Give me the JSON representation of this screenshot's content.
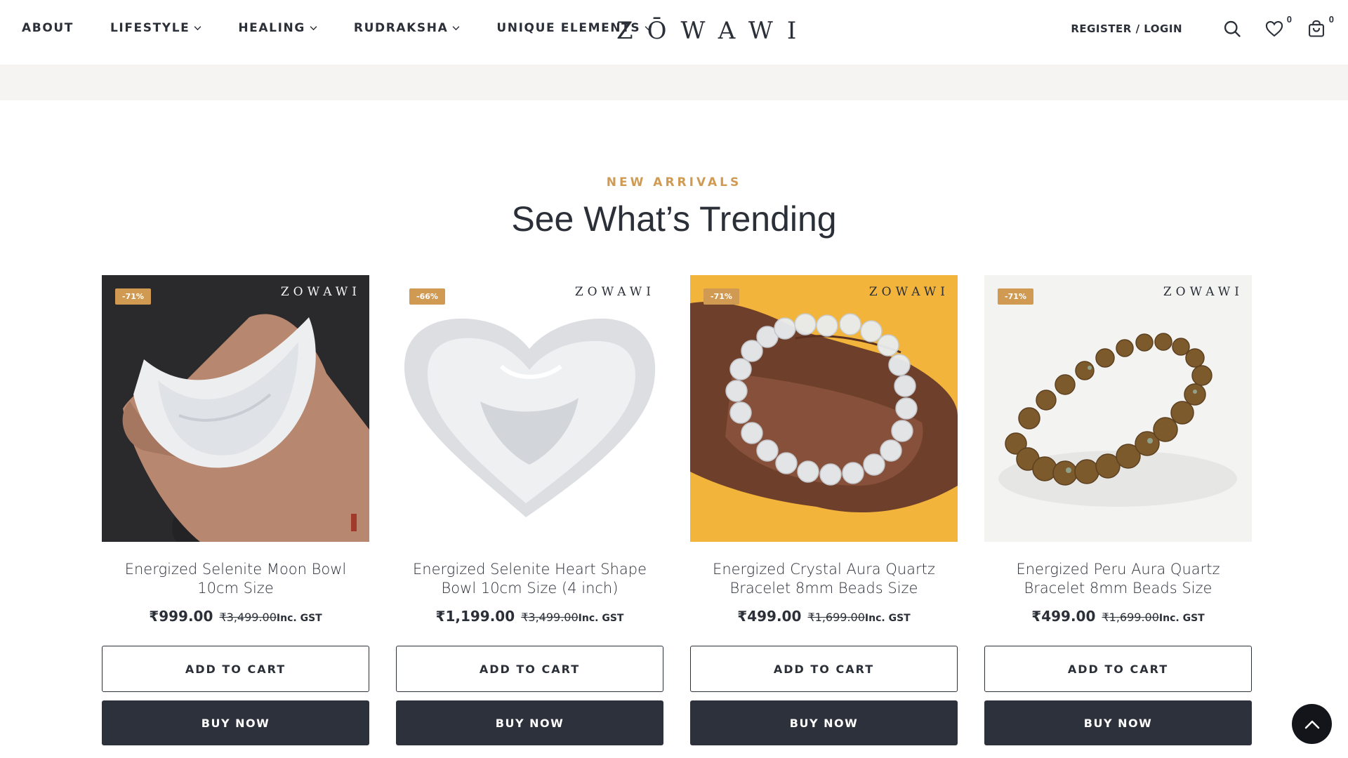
{
  "header": {
    "nav": [
      {
        "label": "ABOUT",
        "dropdown": false
      },
      {
        "label": "LIFESTYLE",
        "dropdown": true
      },
      {
        "label": "HEALING",
        "dropdown": true
      },
      {
        "label": "RUDRAKSHA",
        "dropdown": true
      },
      {
        "label": "UNIQUE ELEMENTS",
        "dropdown": true
      }
    ],
    "logo": "ZŌWAWI",
    "register_login": "REGISTER / LOGIN",
    "wishlist_count": "0",
    "cart_count": "0"
  },
  "section": {
    "eyebrow": "NEW ARRIVALS",
    "title": "See What’s Trending"
  },
  "products": [
    {
      "badge": "-71%",
      "watermark": "ZOWAWI",
      "name": "Energized Selenite Moon Bowl 10cm Size",
      "price": "₹999.00",
      "old_price": "₹3,499.00",
      "tax_note": "Inc. GST",
      "add_label": "ADD TO CART",
      "buy_label": "BUY NOW"
    },
    {
      "badge": "-66%",
      "watermark": "ZOWAWI",
      "name": "Energized Selenite Heart Shape Bowl 10cm Size (4 inch)",
      "price": "₹1,199.00",
      "old_price": "₹3,499.00",
      "tax_note": "Inc. GST",
      "add_label": "ADD TO CART",
      "buy_label": "BUY NOW"
    },
    {
      "badge": "-71%",
      "watermark": "ZOWAWI",
      "name": "Energized Crystal Aura Quartz Bracelet 8mm Beads Size",
      "price": "₹499.00",
      "old_price": "₹1,699.00",
      "tax_note": "Inc. GST",
      "add_label": "ADD TO CART",
      "buy_label": "BUY NOW"
    },
    {
      "badge": "-71%",
      "watermark": "ZOWAWI",
      "name": "Energized Peru Aura Quartz Bracelet 8mm Beads Size",
      "price": "₹499.00",
      "old_price": "₹1,699.00",
      "tax_note": "Inc. GST",
      "add_label": "ADD TO CART",
      "buy_label": "BUY NOW"
    }
  ],
  "icons": {
    "search": "search-icon",
    "wishlist": "heart-icon",
    "cart": "shopping-bag-icon",
    "scroll_top": "chevron-up-icon"
  },
  "colors": {
    "accent": "#d19a52",
    "dark": "#2c313c",
    "band": "#f5f4f2"
  }
}
